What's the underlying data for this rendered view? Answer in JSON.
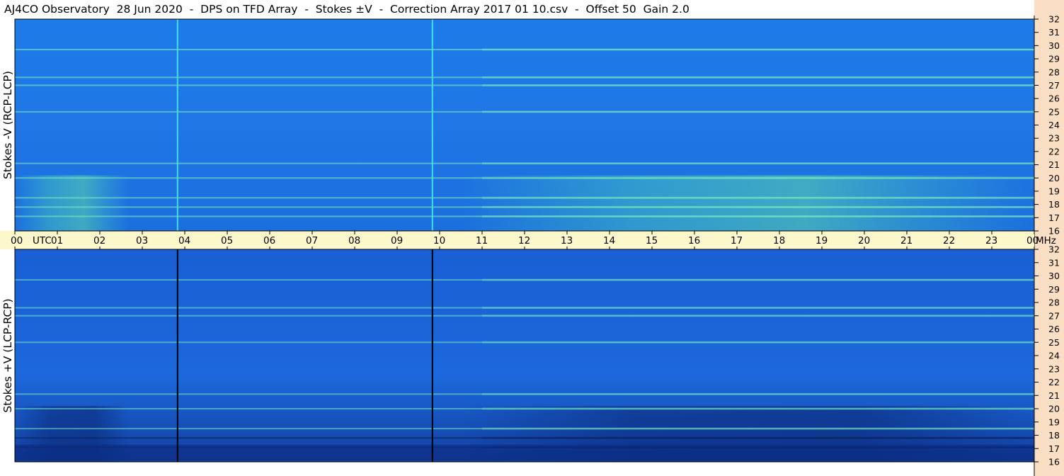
{
  "title": "AJ4CO Observatory  28 Jun 2020  -  DPS on TFD Array  -  Stokes ±V  -  Correction Array 2017 01 10.csv  -  Offset 50  Gain 2.0",
  "chart_data": {
    "type": "heatmap",
    "title": "AJ4CO Observatory  28 Jun 2020  -  DPS on TFD Array  -  Stokes ±V  -  Correction Array 2017 01 10.csv  -  Offset 50  Gain 2.0",
    "x_axis": {
      "range": [
        0,
        24
      ],
      "ticks": [
        "00",
        "01",
        "02",
        "03",
        "04",
        "05",
        "06",
        "07",
        "08",
        "09",
        "10",
        "11",
        "12",
        "13",
        "14",
        "15",
        "16",
        "17",
        "18",
        "19",
        "20",
        "21",
        "22",
        "23",
        "00"
      ],
      "label_prefix": "UTC"
    },
    "y_axis": {
      "range": [
        16,
        32
      ],
      "ticks": [
        "16",
        "17",
        "18",
        "19",
        "20",
        "21",
        "22",
        "23",
        "24",
        "25",
        "26",
        "27",
        "28",
        "29",
        "30",
        "31",
        "32"
      ],
      "unit": "MHz"
    },
    "panels": [
      {
        "name": "Stokes -V (RCP-LCP)",
        "ylabel": "Stokes -V (RCP-LCP)",
        "base_color": "#1e6fe0"
      },
      {
        "name": "Stokes +V (LCP-RCP)",
        "ylabel": "Stokes +V (LCP-RCP)",
        "base_color": "#1a63d8"
      }
    ],
    "features": {
      "vertical_lines_utc": [
        3.83,
        9.83
      ],
      "interference_bands_mhz": [
        17.1,
        17.8,
        18.5,
        20.0,
        21.1,
        25.0,
        27.0,
        27.6,
        29.7
      ],
      "activity_windows_utc": [
        [
          0.0,
          2.7
        ],
        [
          10.5,
          24.0
        ]
      ]
    },
    "colors": {
      "strip_bg": "#fdf8cc",
      "right_axis_bg": "#fbdfc4",
      "heat_low": "#0a2f8a",
      "heat_mid": "#1f74e6",
      "heat_high": "#4ce0a0"
    }
  }
}
